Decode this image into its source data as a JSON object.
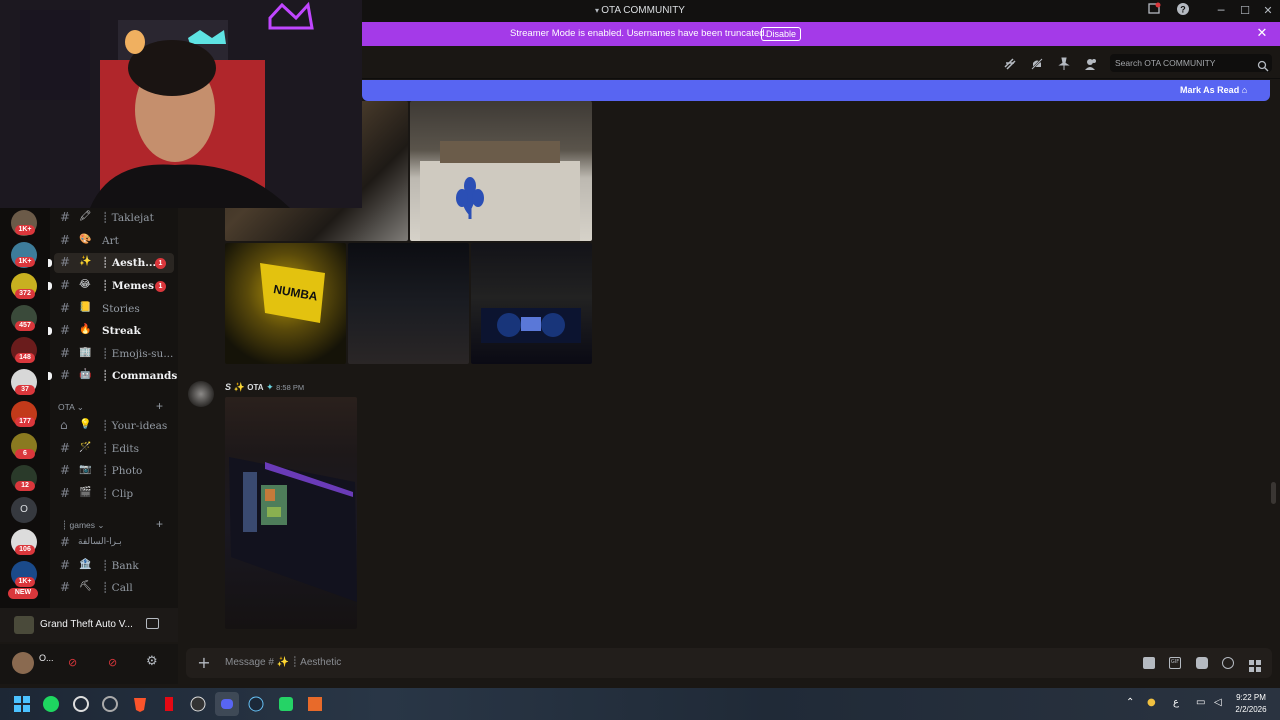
{
  "window": {
    "title": "OTA COMMUNITY"
  },
  "streamer_banner": {
    "text": "Streamer Mode is enabled. Usernames have been truncated.",
    "button": "Disable"
  },
  "header": {
    "search_placeholder": "Search OTA COMMUNITY"
  },
  "new_messages_bar": {
    "label": "Mark As Read"
  },
  "server_rail": {
    "badges": [
      "1K+",
      "1K+",
      "372",
      "457",
      "148",
      "37",
      "177",
      "6",
      "12",
      "106",
      "1K+"
    ],
    "letter_server": "O",
    "new_pill": "NEW"
  },
  "channels": [
    {
      "emoji": "🖍",
      "name": "Taklejat",
      "bold": false
    },
    {
      "emoji": "🎨",
      "name": "Art",
      "bold": false
    },
    {
      "emoji": "✨",
      "name": "Aesth...",
      "bold": true,
      "badge": "1"
    },
    {
      "emoji": "😂",
      "name": "Memes",
      "bold": true,
      "badge": "1"
    },
    {
      "emoji": "📒",
      "name": "Stories",
      "bold": false
    },
    {
      "emoji": "🔥",
      "name": "Streak",
      "bold": true
    },
    {
      "emoji": "🏢",
      "name": "Emojis-su...",
      "bold": false
    },
    {
      "emoji": "🤖",
      "name": "Commands",
      "bold": true
    }
  ],
  "category_ota": {
    "name": "OTA",
    "channels": [
      {
        "emoji": "💡",
        "name": "Your-ideas"
      },
      {
        "emoji": "🪄",
        "name": "Edits"
      },
      {
        "emoji": "📷",
        "name": "Photo"
      },
      {
        "emoji": "🎬",
        "name": "Clip"
      }
    ]
  },
  "category_games": {
    "name": "games",
    "channels": [
      {
        "emoji": "",
        "name": "بـرا-السالفة"
      },
      {
        "emoji": "🏦",
        "name": "Bank"
      },
      {
        "emoji": "⛏",
        "name": "Call"
      }
    ]
  },
  "activity": {
    "text": "Grand Theft Auto V..."
  },
  "user": {
    "name": "O..."
  },
  "message": {
    "author": "S",
    "role": "OTA",
    "time": "8:58 PM"
  },
  "composer": {
    "placeholder": "Message # ✨ ┊ Aesthetic"
  },
  "taskbar": {
    "time": "9:22 PM",
    "date": "2/2/2026",
    "lang": "ع"
  },
  "colors": {
    "streamer": "#a43ae8",
    "blurple": "#5865f2",
    "badge_red": "#da373c"
  }
}
